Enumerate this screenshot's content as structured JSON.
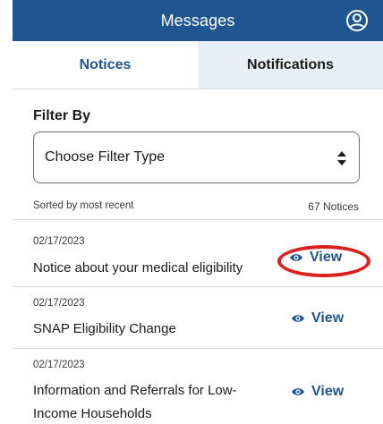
{
  "header": {
    "title": "Messages",
    "profile_icon": "account-circle-icon"
  },
  "tabs": [
    {
      "label": "Notices",
      "selected": true
    },
    {
      "label": "Notifications",
      "selected": false
    }
  ],
  "filter": {
    "label": "Filter By",
    "selected_value": "Choose Filter Type",
    "icon": "sort-arrows-icon"
  },
  "list_meta": {
    "sort_text": "Sorted by most recent",
    "count_text": "67 Notices"
  },
  "notices": [
    {
      "date": "02/17/2023",
      "title": "Notice about your medical eligibility",
      "action": "View"
    },
    {
      "date": "02/17/2023",
      "title": "SNAP Eligibility Change",
      "action": "View"
    },
    {
      "date": "02/17/2023",
      "title": "Information and Referrals for Low-Income Households",
      "action": "View"
    }
  ],
  "colors": {
    "brand": "#1f5591",
    "selected_tab_bg": "#ffffff",
    "unselected_tab_bg": "#e8eff7",
    "annotation_ring": "#d9201c"
  },
  "view_icon": "eye-icon"
}
